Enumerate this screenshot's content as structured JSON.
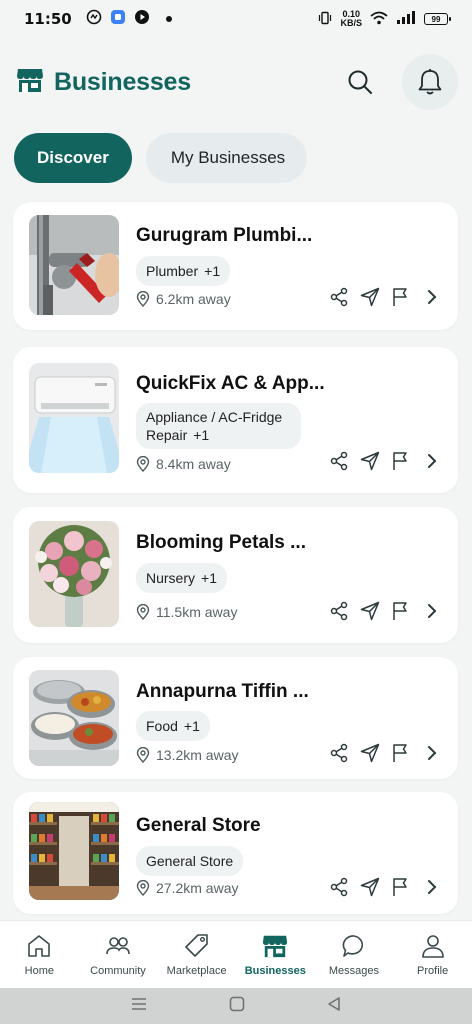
{
  "status_bar": {
    "time": "11:50",
    "net_speed_value": "0.10",
    "net_speed_unit": "KB/S",
    "battery": "99"
  },
  "header": {
    "title": "Businesses"
  },
  "tabs": [
    {
      "label": "Discover"
    },
    {
      "label": "My Businesses"
    }
  ],
  "businesses": [
    {
      "name": "Gurugram Plumbi...",
      "category": "Plumber",
      "extra": "+1",
      "distance": "6.2km away",
      "image": "plumber-wrench"
    },
    {
      "name": "QuickFix AC & App...",
      "category": "Appliance / AC-Fridge Repair",
      "extra": "+1",
      "distance": "8.4km away",
      "image": "air-conditioner"
    },
    {
      "name": "Blooming Petals ...",
      "category": "Nursery",
      "extra": "+1",
      "distance": "11.5km away",
      "image": "flower-bouquet"
    },
    {
      "name": "Annapurna Tiffin ...",
      "category": "Food",
      "extra": "+1",
      "distance": "13.2km away",
      "image": "tiffin-box"
    },
    {
      "name": "General Store",
      "category": "General Store",
      "extra": "",
      "distance": "27.2km away",
      "image": "store-shelves"
    }
  ],
  "bottom_nav": [
    {
      "label": "Home",
      "icon": "home-icon"
    },
    {
      "label": "Community",
      "icon": "community-icon"
    },
    {
      "label": "Marketplace",
      "icon": "tag-icon"
    },
    {
      "label": "Businesses",
      "icon": "store-icon"
    },
    {
      "label": "Messages",
      "icon": "chat-icon"
    },
    {
      "label": "Profile",
      "icon": "profile-icon"
    }
  ],
  "colors": {
    "accent": "#12655e",
    "background": "#f3f5f5",
    "card": "#ffffff",
    "chip": "#eef2f3"
  }
}
